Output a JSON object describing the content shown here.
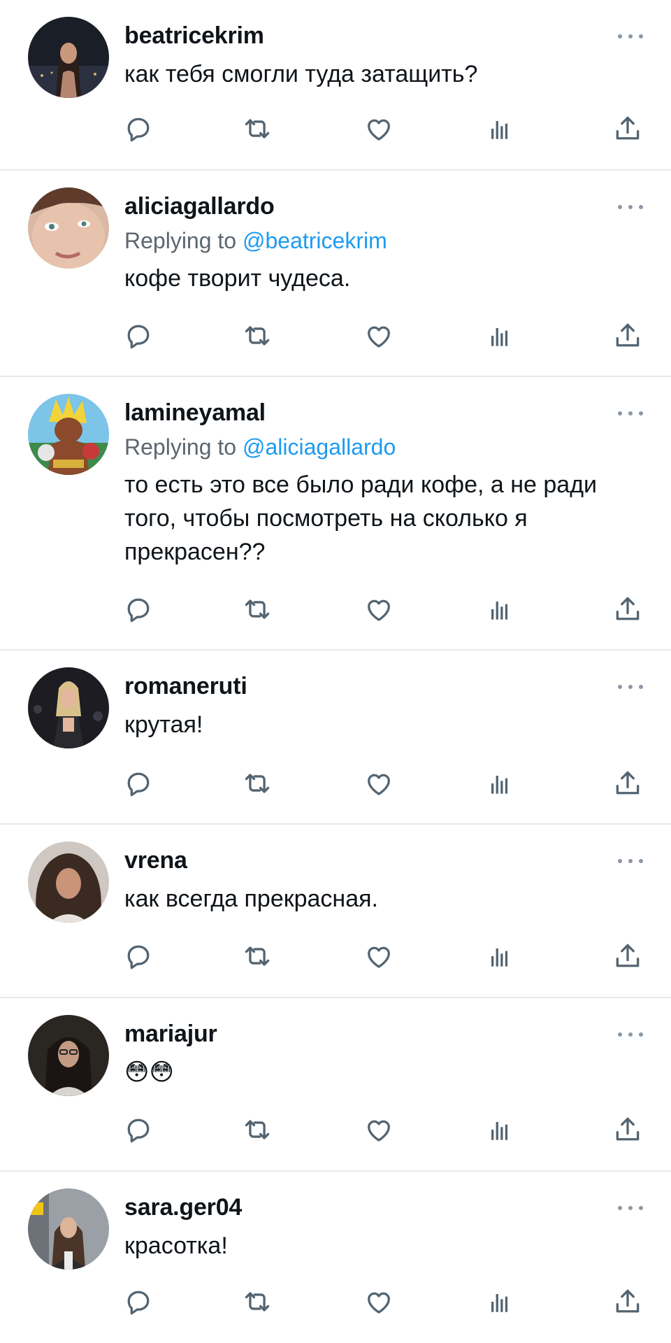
{
  "tweets": [
    {
      "username": "beatricekrim",
      "replying_prefix": "",
      "replying_to": "",
      "text": "как тебя смогли туда затащить?"
    },
    {
      "username": "aliciagallardo",
      "replying_prefix": "Replying to ",
      "replying_to": "@beatricekrim",
      "text": "кофе творит чудеса."
    },
    {
      "username": "lamineyamal",
      "replying_prefix": "Replying to ",
      "replying_to": "@aliciagallardo",
      "text": "то есть это все было ради кофе, а не ради того, чтобы посмотреть на сколько я прекрасен??"
    },
    {
      "username": "romaneruti",
      "replying_prefix": "",
      "replying_to": "",
      "text": "крутая!"
    },
    {
      "username": "vrena",
      "replying_prefix": "",
      "replying_to": "",
      "text": "как всегда прекрасная."
    },
    {
      "username": "mariajur",
      "replying_prefix": "",
      "replying_to": "",
      "text": "😳😳"
    },
    {
      "username": "sara.ger04",
      "replying_prefix": "",
      "replying_to": "",
      "text": "красотка!"
    }
  ],
  "icons": {
    "more": "more-dots-icon",
    "reply": "reply-bubble-icon",
    "retweet": "retweet-icon",
    "like": "heart-icon",
    "views": "bar-chart-icon",
    "share": "share-icon"
  },
  "colors": {
    "text": "#0f1419",
    "secondary": "#5b6670",
    "mention": "#1d9bf0",
    "icon": "#536471",
    "divider": "#e6e9ec"
  }
}
